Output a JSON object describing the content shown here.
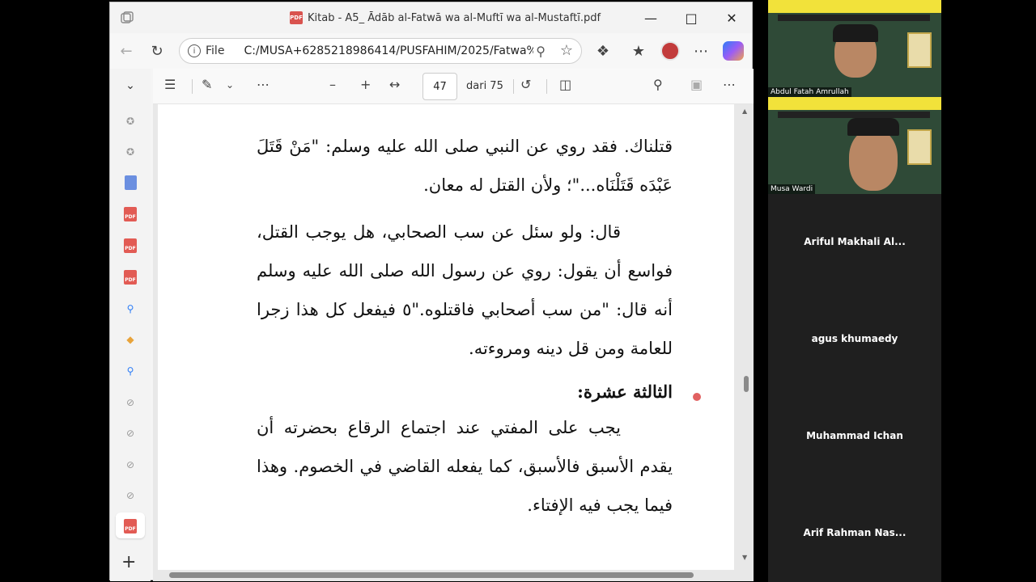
{
  "browser": {
    "title": "Kitab - A5_ Ādāb al-Fatwā wa al-Muftī wa al-Mustaftī.pdf",
    "scheme_label": "File",
    "url": "C:/MUSA+6285218986414/PUSFAHIM/2025/Fatwa%..."
  },
  "pdf_toolbar": {
    "current_page": "47",
    "total_pages": "dari 75"
  },
  "pdf_page": {
    "lines": [
      "قتلناك. فقد روي عن النبي صلى الله عليه وسلم: \"مَنْ قَتَلَ عَبْدَه قَتَلْنَاه...\"؛ ولأن القتل له معان.",
      "قال: ولو سئل عن سب الصحابي، هل يوجب القتل، فواسع أن يقول: روي عن رسول الله صلى الله عليه وسلم أنه قال: \"من سب أصحابي فاقتلوه.\"٥ فيفعل كل هذا زجرا للعامة ومن قل دينه ومروءته.",
      "الثالثة عشرة:",
      "يجب على المفتي عند اجتماع الرقاع بحضرته أن يقدم الأسبق فالأسبق، كما يفعله القاضي في الخصوم. وهذا فيما يجب فيه الإفتاء."
    ]
  },
  "participants": [
    {
      "name": "Abdul Fatah Amrullah",
      "video": true
    },
    {
      "name": "Musa Wardi",
      "video": true
    },
    {
      "name": "Ariful Makhali Al...",
      "video": false
    },
    {
      "name": "agus khumaedy",
      "video": false
    },
    {
      "name": "Muhammad Ichan",
      "video": false
    },
    {
      "name": "Arif Rahman Nas...",
      "video": false
    }
  ],
  "colors": {
    "pdf_icon": "#e25b54",
    "accent": "#2d7df6"
  }
}
